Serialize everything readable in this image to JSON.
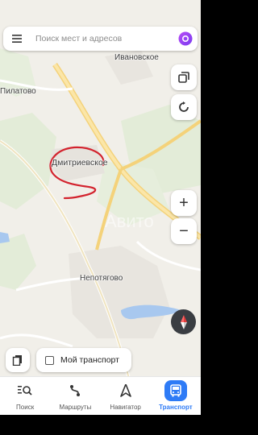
{
  "search": {
    "placeholder": "Поиск мест и адресов"
  },
  "map": {
    "places": [
      {
        "id": "ivanovskoe",
        "name": "Ивановское"
      },
      {
        "id": "pilatovo",
        "name": "Пилатово"
      },
      {
        "id": "dmitrievskoe",
        "name": "Дмитриевское"
      },
      {
        "id": "nepotyagovo",
        "name": "Непотягово"
      }
    ],
    "watermark": "Авито",
    "annotation_color": "#d3232e"
  },
  "controls": {
    "layers_icon": "square-stack-icon",
    "navigator_icon": "loop-arrow-icon",
    "zoom_in": "+",
    "zoom_out": "−",
    "compass_icon": "compass-icon"
  },
  "transport_toggle": {
    "label": "Мой транспорт",
    "checked": false
  },
  "tabs": [
    {
      "label": "Поиск",
      "icon": "search-list-icon",
      "active": false
    },
    {
      "label": "Маршруты",
      "icon": "route-icon",
      "active": false
    },
    {
      "label": "Навигатор",
      "icon": "navigator-arrow-icon",
      "active": false
    },
    {
      "label": "Транспорт",
      "icon": "bus-icon",
      "active": true
    }
  ],
  "colors": {
    "accent": "#2e7bf6",
    "road": "#f4d27a",
    "water": "#a8c8ef",
    "forest": "#dbe9cf"
  }
}
